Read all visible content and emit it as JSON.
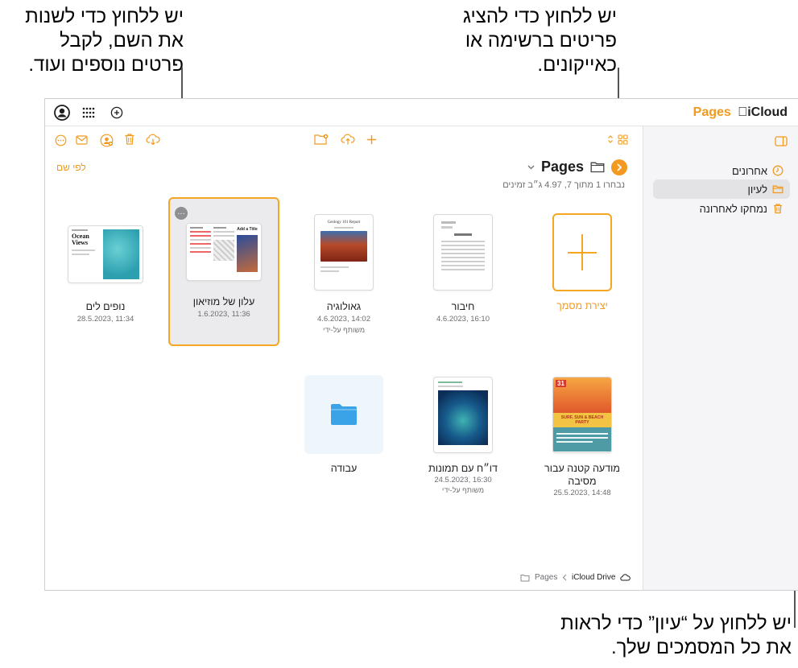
{
  "callouts": {
    "top_left": [
      "יש ללחוץ כדי לשנות",
      "את השם, לקבל",
      "פרטים נוספים ועוד."
    ],
    "top_right": [
      "יש ללחוץ כדי להציג",
      "פריטים ברשימה או",
      "כאייקונים."
    ],
    "bottom": [
      "יש ללחוץ על “עיון” כדי לראות",
      "את כל המסמכים שלך."
    ]
  },
  "app": {
    "brand_pages": "Pages",
    "brand_icloud": "iCloud"
  },
  "sidebar": {
    "items": [
      {
        "label": "אחרונים",
        "icon": "clock-icon"
      },
      {
        "label": "לעיון",
        "icon": "folder-icon",
        "selected": true
      },
      {
        "label": "נמחקו לאחרונה",
        "icon": "trash-icon"
      }
    ]
  },
  "main": {
    "title": "Pages",
    "subtitle": "נבחרו 1 מתוך 7, 4.97 ג״ב זמינים",
    "sort_label": "לפי שם"
  },
  "documents": [
    {
      "name": "יצירת מסמך",
      "meta": "",
      "shared": "",
      "kind": "new"
    },
    {
      "name": "חיבור",
      "meta": "4.6.2023, 16:10",
      "shared": "",
      "kind": "essay"
    },
    {
      "name": "גאולוגיה",
      "meta": "4.6.2023, 14:02",
      "shared": "משותף על-ידי",
      "kind": "geo",
      "thumb_title": "Geology 101 Report"
    },
    {
      "name": "עלון של מוזיאון",
      "meta": "1.6.2023, 11:36",
      "shared": "",
      "kind": "museum",
      "selected": true,
      "thumb_title": "Add a Title"
    },
    {
      "name": "נופים לים",
      "meta": "28.5.2023, 11:34",
      "shared": "",
      "kind": "ocean",
      "thumb_title": "Ocean Views"
    },
    {
      "name": "מודעה קטנה עבור מסיבה",
      "meta": "25.5.2023, 14:48",
      "shared": "",
      "kind": "party",
      "thumb_title": "SURF, SUN & BEACH PARTY",
      "thumb_num": "31"
    },
    {
      "name": "דו״ח עם תמונות",
      "meta": "24.5.2023, 16:30",
      "shared": "משותף על-ידי",
      "kind": "photo"
    },
    {
      "name": "עבודה",
      "meta": "",
      "shared": "",
      "kind": "folder"
    }
  ],
  "breadcrumbs": {
    "root": "iCloud Drive",
    "current": "Pages"
  },
  "colors": {
    "accent": "#f29a1f",
    "folder": "#3aa2e6"
  }
}
